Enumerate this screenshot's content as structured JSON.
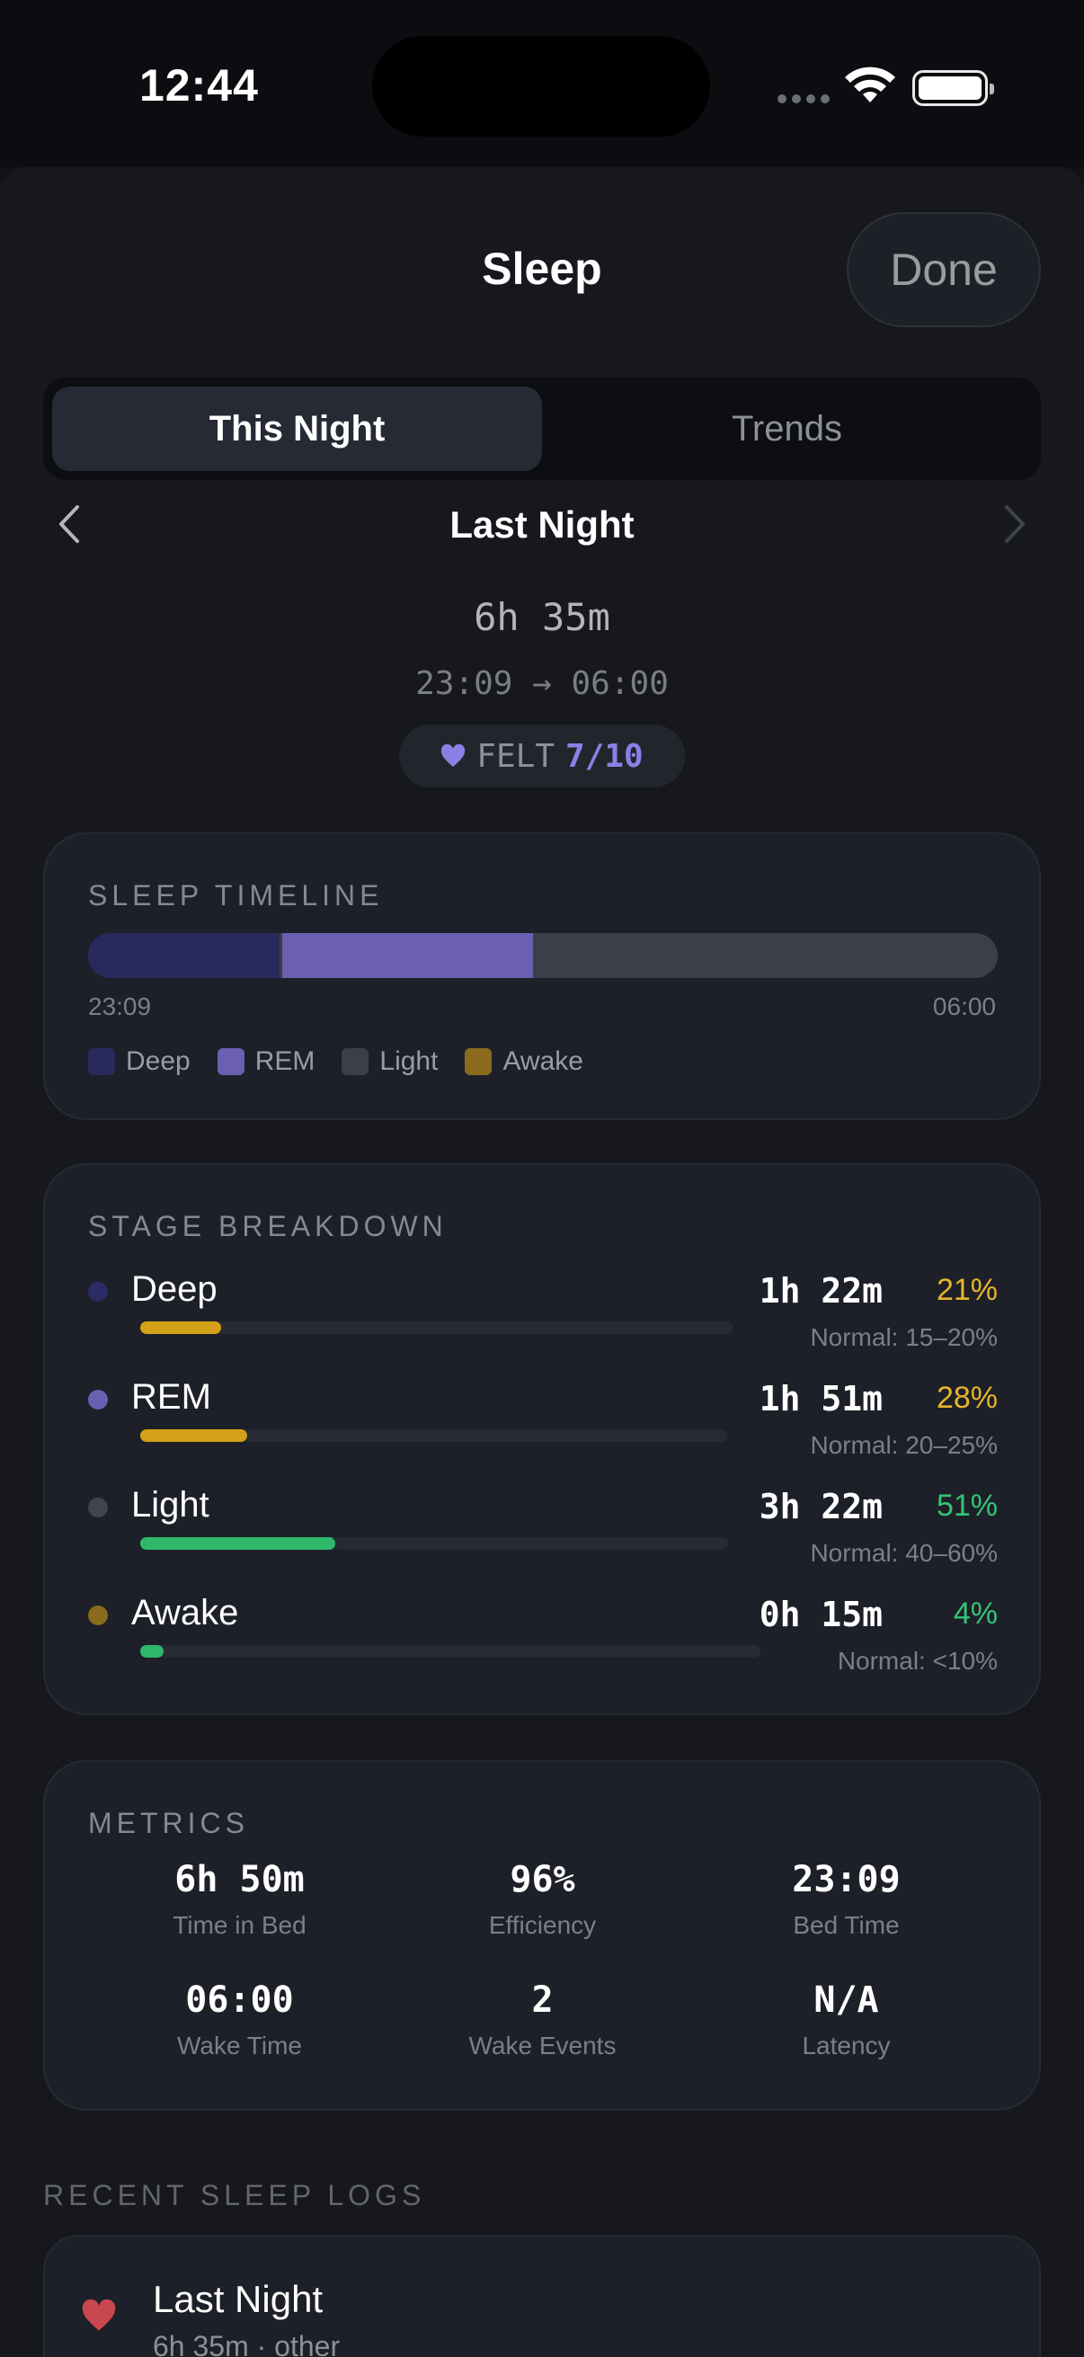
{
  "status_bar": {
    "time": "12:44"
  },
  "header": {
    "title": "Sleep",
    "done_label": "Done"
  },
  "tabs": [
    {
      "label": "This Night",
      "active": true
    },
    {
      "label": "Trends",
      "active": false
    }
  ],
  "date_nav": {
    "title": "Last Night"
  },
  "summary": {
    "duration": "6h 35m",
    "range": "23:09 → 06:00",
    "felt_label": "FELT",
    "felt_value": "7/10"
  },
  "timeline": {
    "title": "SLEEP TIMELINE",
    "start": "23:09",
    "end": "06:00",
    "segments": [
      {
        "stage": "Deep",
        "fraction": 0.21
      },
      {
        "stage": "REM",
        "fraction": 0.28
      },
      {
        "stage": "Light",
        "fraction": 0.51
      }
    ],
    "legend": [
      {
        "label": "Deep",
        "color": "#282a5e"
      },
      {
        "label": "REM",
        "color": "#6a5fb0"
      },
      {
        "label": "Light",
        "color": "#3a3f4a"
      },
      {
        "label": "Awake",
        "color": "#8a6a1c"
      }
    ]
  },
  "breakdown": {
    "title": "STAGE BREAKDOWN",
    "stages": [
      {
        "name": "Deep",
        "duration": "1h 22m",
        "percent": "21%",
        "normal": "Normal: 15–20%",
        "dot_color": "#2a2c66",
        "bar_color": "#d4a017",
        "pct_color": "#e7b42a",
        "fill": 0.21
      },
      {
        "name": "REM",
        "duration": "1h 51m",
        "percent": "28%",
        "normal": "Normal: 20–25%",
        "dot_color": "#6a5fb0",
        "bar_color": "#d4a017",
        "pct_color": "#e7b42a",
        "fill": 0.28
      },
      {
        "name": "Light",
        "duration": "3h 22m",
        "percent": "51%",
        "normal": "Normal: 40–60%",
        "dot_color": "#3f4450",
        "bar_color": "#2fb86b",
        "pct_color": "#34c477",
        "fill": 0.51
      },
      {
        "name": "Awake",
        "duration": "0h 15m",
        "percent": "4%",
        "normal": "Normal: <10%",
        "dot_color": "#8a6a1c",
        "bar_color": "#2fb86b",
        "pct_color": "#34c477",
        "fill": 0.04
      }
    ]
  },
  "metrics": {
    "title": "METRICS",
    "items": [
      {
        "value": "6h 50m",
        "label": "Time in Bed"
      },
      {
        "value": "96%",
        "label": "Efficiency"
      },
      {
        "value": "23:09",
        "label": "Bed Time"
      },
      {
        "value": "06:00",
        "label": "Wake Time"
      },
      {
        "value": "2",
        "label": "Wake Events"
      },
      {
        "value": "N/A",
        "label": "Latency"
      }
    ]
  },
  "recent": {
    "title": "RECENT SLEEP LOGS",
    "logs": [
      {
        "title": "Last Night",
        "subtitle": "6h 35m · other",
        "icon": "heart-icon"
      }
    ]
  }
}
